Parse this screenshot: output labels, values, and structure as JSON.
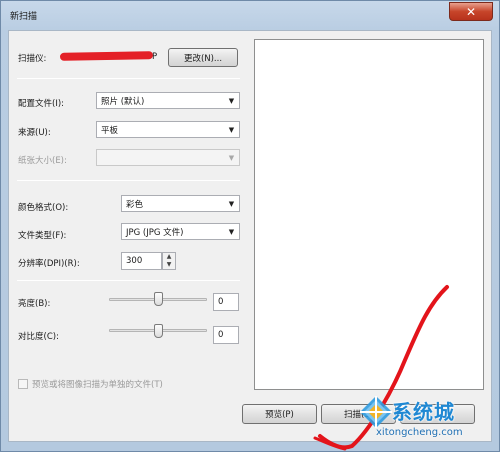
{
  "window": {
    "title": "新扫描",
    "close_glyph": "✕"
  },
  "scanner": {
    "label": "扫描仪:",
    "name_visible_suffix": "P",
    "change_button": "更改(N)..."
  },
  "form": {
    "profile": {
      "label": "配置文件(I):",
      "value": "照片 (默认)"
    },
    "source": {
      "label": "来源(U):",
      "value": "平板"
    },
    "paper_size": {
      "label": "纸张大小(E):",
      "value": ""
    },
    "color_format": {
      "label": "颜色格式(O):",
      "value": "彩色"
    },
    "file_type": {
      "label": "文件类型(F):",
      "value": "JPG (JPG 文件)"
    },
    "resolution": {
      "label": "分辨率(DPI)(R):",
      "value": "300"
    },
    "brightness": {
      "label": "亮度(B):",
      "value": "0"
    },
    "contrast": {
      "label": "对比度(C):",
      "value": "0"
    },
    "separate_files": {
      "label": "预览或将图像扫描为单独的文件(T)",
      "checked": false
    }
  },
  "buttons": {
    "preview": "预览(P)",
    "scan": "扫描(S)"
  },
  "icons": {
    "dropdown": "▼",
    "spin_up": "▲",
    "spin_down": "▼"
  },
  "watermark": {
    "text": "系统城",
    "url": "xitongcheng.com",
    "color": "#1f88d3"
  },
  "annotation_color": "#e3141b"
}
